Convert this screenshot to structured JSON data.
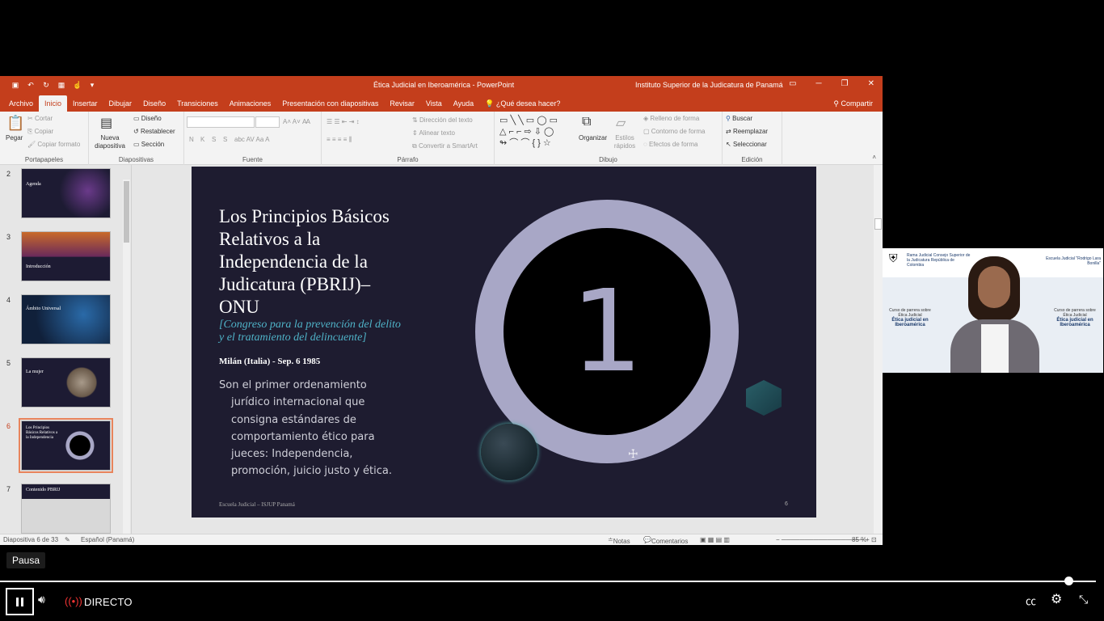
{
  "window": {
    "doc_title": "Ética Judicial en Iberoamérica  -  PowerPoint",
    "account": "Instituto Superior de la Judicatura de Panamá",
    "buttons": [
      "▭",
      "─",
      "❐",
      "✕"
    ]
  },
  "tabs": [
    "Archivo",
    "Inicio",
    "Insertar",
    "Dibujar",
    "Diseño",
    "Transiciones",
    "Animaciones",
    "Presentación con diapositivas",
    "Revisar",
    "Vista",
    "Ayuda",
    "¿Qué desea hacer?"
  ],
  "share": "Compartir",
  "ribbon": {
    "portapapeles": {
      "label": "Portapapeles",
      "paste": "Pegar",
      "cut": "Cortar",
      "copy": "Copiar",
      "format": "Copiar formato"
    },
    "diapositivas": {
      "label": "Diapositivas",
      "new": "Nueva diapositiva",
      "design": "Diseño",
      "reset": "Restablecer",
      "section": "Sección"
    },
    "fuente": {
      "label": "Fuente",
      "bold": "N",
      "italic": "K",
      "underline": "S",
      "strike": "S"
    },
    "parrafo": {
      "label": "Párrafo",
      "dir": "Dirección del texto",
      "align": "Alinear texto",
      "smartart": "Convertir a SmartArt"
    },
    "dibujo": {
      "label": "Dibujo",
      "organize": "Organizar",
      "quick": "Estilos rápidos",
      "fill": "Relleno de forma",
      "outline": "Contorno de forma",
      "effects": "Efectos de forma"
    },
    "edicion": {
      "label": "Edición",
      "find": "Buscar",
      "replace": "Reemplazar",
      "select": "Seleccionar"
    }
  },
  "thumbnails": [
    {
      "num": "2",
      "title": "Agenda"
    },
    {
      "num": "3",
      "title": "Introducción"
    },
    {
      "num": "4",
      "title": "Ámbito Universal"
    },
    {
      "num": "5",
      "title": "La mujer"
    },
    {
      "num": "6",
      "title": "Los Principios Básicos Relativos a la Independencia"
    },
    {
      "num": "7",
      "title": "Contenido PBRIJ"
    }
  ],
  "slide": {
    "title": "Los Principios Básicos Relativos a la Independencia de la Judicatura (PBRIJ)– ONU",
    "subtitle": "[Congreso para la prevención del delito y el tratamiento del delincuente]",
    "place": "Milán (Italia) - Sep. 6 1985",
    "body": "Son el primer ordenamiento jurídico internacional que consigna estándares de comportamiento ético para jueces: Independencia, promoción, juicio justo y ética.",
    "number": "1",
    "footer": "Escuela Judicial – ISJUP Panamá",
    "page": "6"
  },
  "status": {
    "slide_counter": "Diapositiva 6 de 33",
    "language": "Español (Panamá)",
    "notes": "Notas",
    "comments": "Comentarios",
    "zoom": "85 %"
  },
  "webcam": {
    "org_left": "Rama Judicial Consejo Superior de la Judicatura República de Colombia",
    "org_right": "Escuela Judicial \"Rodrigo Lara Bonilla\"",
    "course_caption": "Curso de parrera sobre Ética Judicial",
    "course_title": "Ética judicial en Iberoamérica"
  },
  "player": {
    "tooltip": "Pausa",
    "live_label": "DIRECTO",
    "progress": 0.975
  }
}
